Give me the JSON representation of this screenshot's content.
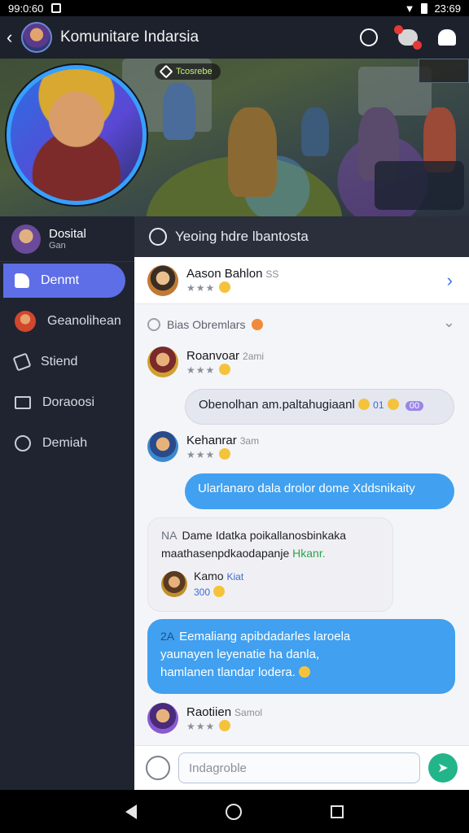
{
  "status_bar": {
    "time": "99:0:60",
    "right_time": "23:69"
  },
  "top_bar": {
    "title": "Komunitare Indarsia"
  },
  "banner": {
    "tag": "Tcosrebe"
  },
  "sidebar": {
    "user": {
      "name": "Dosital",
      "sub": "Gan"
    },
    "items": [
      {
        "label": "Denmt",
        "icon": "thumb-icon",
        "active": true
      },
      {
        "label": "Geanolihean",
        "icon": "avatar-icon",
        "active": false
      },
      {
        "label": "Stiend",
        "icon": "shop-icon",
        "active": false
      },
      {
        "label": "Doraoosi",
        "icon": "chart-icon",
        "active": false
      },
      {
        "label": "Demiah",
        "icon": "circle-icon",
        "active": false
      }
    ]
  },
  "main": {
    "header": {
      "title": "Yeoing hdre lbantosta"
    },
    "pinned": {
      "name": "Aason Bahlon",
      "tag": "SS",
      "stars": "★★★"
    },
    "section": {
      "label": "Bias Obremlars"
    },
    "messages": [
      {
        "name": "Roanvoar",
        "time": "2ami",
        "stars": "★★★"
      },
      {
        "bubble": "Obenolhan am.paltahugiaanl",
        "num": "01",
        "badge": "00"
      },
      {
        "name": "Kehanrar",
        "time": "3am",
        "stars": "★★★"
      },
      {
        "bubble": "Ularlanaro dala drolor dome Xddsnikaity"
      },
      {
        "num_label": "NA",
        "line1": "Dame Idatka poikallanosbinkaka",
        "line2_a": "maathasenpdkaodapanje",
        "line2_b": "Hkanr.",
        "reply_name": "Kamo",
        "reply_tag": "Kiat",
        "reply_num": "300"
      },
      {
        "num_label": "2A",
        "line1": "Eemaliang apibdadarles laroela",
        "line2": "yaunayen leyenatie ha danla,",
        "line3": "hamlanen tlandar lodera."
      },
      {
        "name": "Raotiien",
        "time": "Samol",
        "stars": "★★★"
      }
    ],
    "composer": {
      "placeholder": "Indagroble"
    }
  }
}
